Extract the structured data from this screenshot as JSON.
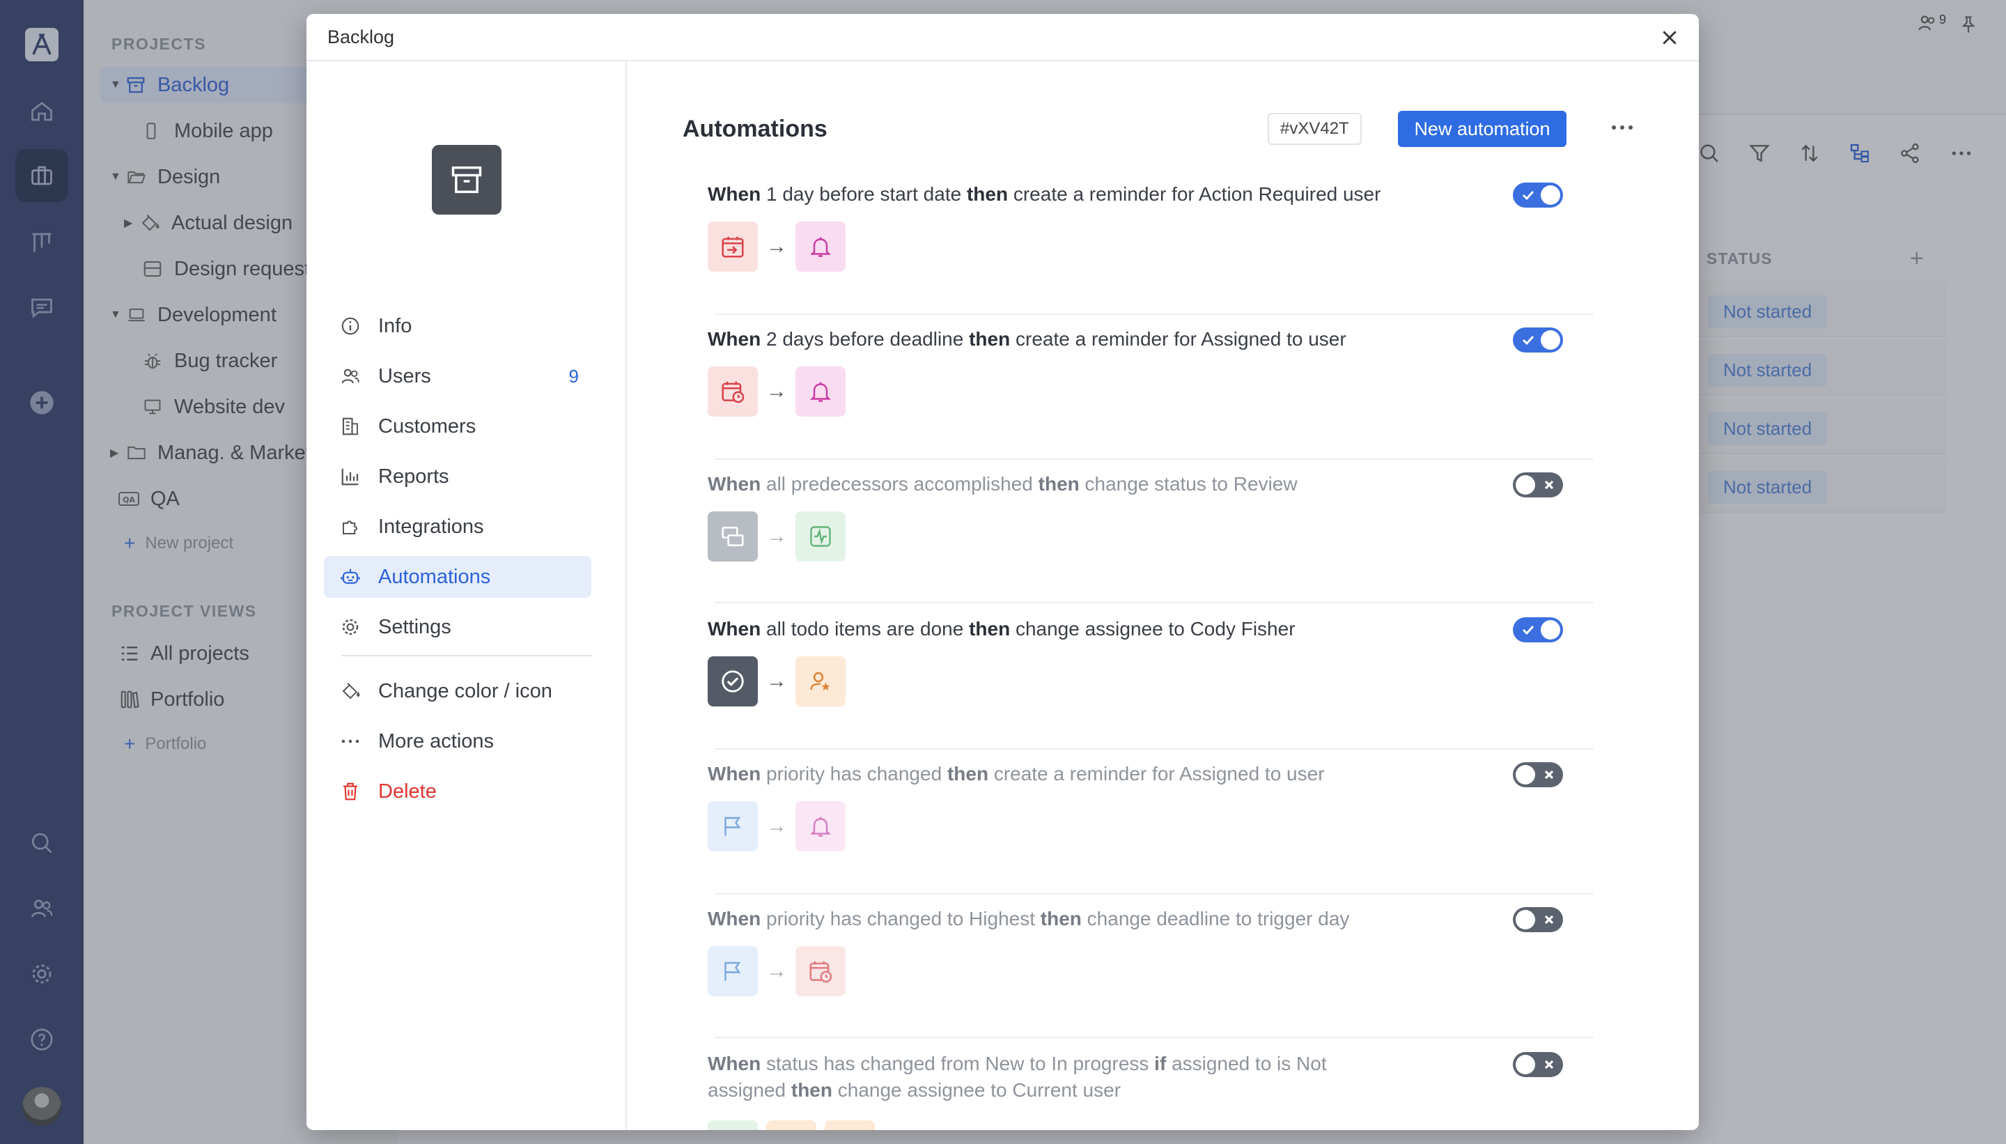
{
  "sidebar": {
    "projects_title": "PROJECTS",
    "tree": [
      {
        "label": "Backlog",
        "selected": true
      },
      {
        "label": "Mobile app"
      },
      {
        "label": "Design"
      },
      {
        "label": "Actual design"
      },
      {
        "label": "Design request"
      },
      {
        "label": "Development"
      },
      {
        "label": "Bug tracker"
      },
      {
        "label": "Website dev"
      },
      {
        "label": "Manag. & Marketing"
      },
      {
        "label": "QA"
      }
    ],
    "new_project": "New project",
    "views_title": "PROJECT VIEWS",
    "views": [
      {
        "label": "All projects"
      },
      {
        "label": "Portfolio"
      }
    ],
    "new_portfolio": "Portfolio"
  },
  "topbar": {
    "users_count": "9"
  },
  "table": {
    "status_header": "STATUS",
    "statuses": [
      "Not started",
      "Not started",
      "Not started",
      "Not started"
    ]
  },
  "modal": {
    "title": "Backlog",
    "menu": [
      {
        "label": "Info",
        "icon": "info-icon"
      },
      {
        "label": "Users",
        "icon": "users-icon",
        "count": "9"
      },
      {
        "label": "Customers",
        "icon": "building-icon"
      },
      {
        "label": "Reports",
        "icon": "chart-icon"
      },
      {
        "label": "Integrations",
        "icon": "puzzle-icon"
      },
      {
        "label": "Automations",
        "icon": "robot-icon",
        "active": true
      },
      {
        "label": "Settings",
        "icon": "gear-icon"
      }
    ],
    "extra_menu": [
      {
        "label": "Change color / icon",
        "icon": "paint-icon"
      },
      {
        "label": "More actions",
        "icon": "dots-icon"
      },
      {
        "label": "Delete",
        "icon": "trash-icon"
      }
    ],
    "automations_title": "Automations",
    "id_badge": "#vXV42T",
    "new_button": "New automation",
    "rules": [
      {
        "w": "When",
        "cond": "1 day before start date",
        "t": "then",
        "action": "create a reminder for Action Required user",
        "enabled": true
      },
      {
        "w": "When",
        "cond": "2 days before deadline",
        "t": "then",
        "action": "create a reminder for Assigned to user",
        "enabled": true
      },
      {
        "w": "When",
        "cond": "all predecessors accomplished",
        "t": "then",
        "action": "change status to Review",
        "enabled": false
      },
      {
        "w": "When",
        "cond": "all todo items are done",
        "t": "then",
        "action": "change assignee to Cody Fisher",
        "enabled": true
      },
      {
        "w": "When",
        "cond": "priority has changed",
        "t": "then",
        "action": "create a reminder for Assigned to user",
        "enabled": false
      },
      {
        "w": "When",
        "cond": "priority has changed to Highest",
        "t": "then",
        "action": "change deadline to trigger day",
        "enabled": false
      },
      {
        "w": "When",
        "cond": "status has changed from New to In progress",
        "i": "if",
        "cond2": "assigned to is Not assigned",
        "t": "then",
        "action": "change assignee to Current user",
        "enabled": false
      }
    ]
  },
  "colors": {
    "accent": "#2e6ce4",
    "rail": "#2e3b6a",
    "danger": "#e0342e"
  }
}
